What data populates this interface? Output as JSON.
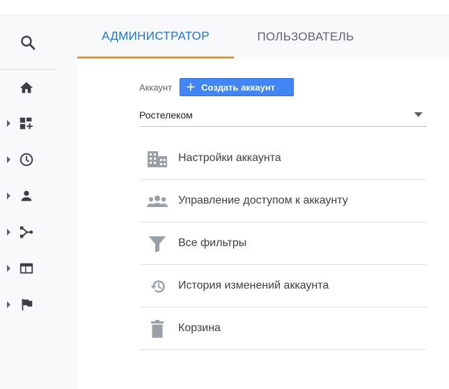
{
  "colors": {
    "accent": "#1a73e8",
    "tab_indicator": "#f29900",
    "create_button": "#4285f4",
    "icon_gray": "#9aa0a6",
    "nav_icon": "#3c4043"
  },
  "sidebar": {
    "search_icon": "search-icon",
    "items": [
      {
        "icon": "home-icon"
      },
      {
        "icon": "dashboard-add-icon"
      },
      {
        "icon": "clock-icon"
      },
      {
        "icon": "person-icon"
      },
      {
        "icon": "acquisition-icon"
      },
      {
        "icon": "web-icon"
      },
      {
        "icon": "flag-icon"
      }
    ]
  },
  "tabs": [
    {
      "label": "АДМИНИСТРАТОР",
      "active": true
    },
    {
      "label": "ПОЛЬЗОВАТЕЛЬ",
      "active": false
    }
  ],
  "account": {
    "label": "Аккаунт",
    "create_button_label": "Создать аккаунт",
    "selected": "Ростелеком"
  },
  "menu": [
    {
      "icon": "building-icon",
      "label": "Настройки аккаунта"
    },
    {
      "icon": "people-icon",
      "label": "Управление доступом к аккаунту"
    },
    {
      "icon": "filter-icon",
      "label": "Все фильтры"
    },
    {
      "icon": "history-icon",
      "label": "История изменений аккаунта"
    },
    {
      "icon": "trash-icon",
      "label": "Корзина"
    }
  ]
}
